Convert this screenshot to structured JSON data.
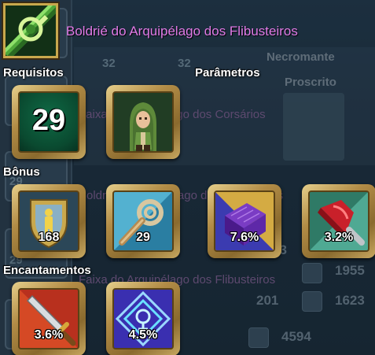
{
  "item": {
    "name": "Boldrié do Arquipélago dos Flibusteiros",
    "icon": "green-belt-icon"
  },
  "sections": {
    "requirements": "Requisitos",
    "parameters": "Parâmetros",
    "bonus": "Bônus",
    "enchantments": "Encantamentos"
  },
  "requirements": {
    "level": "29",
    "character_icon": "hooded-character-icon"
  },
  "bonus": [
    {
      "icon": "shield-figure-icon",
      "value": "168"
    },
    {
      "icon": "wind-swirl-icon",
      "value": "29"
    },
    {
      "icon": "purple-cube-icon",
      "value": "7.6%"
    },
    {
      "icon": "red-hammer-icon",
      "value": "3.2%"
    }
  ],
  "enchantments": [
    {
      "icon": "red-sword-icon",
      "value": "3.6%"
    },
    {
      "icon": "blue-rune-icon",
      "value": "4.5%"
    }
  ],
  "background": {
    "texts": [
      "Necromante",
      "Proscrito",
      "Faixa do Arquipélago dos Corsários",
      "Boldrié do Arquipélago dos Flibusteiros",
      "Faixa do Arquipélago dos Flibusteiros"
    ],
    "levels": [
      "32",
      "32",
      "29",
      "29"
    ],
    "stats": [
      "33",
      "1955",
      "201",
      "1623",
      "4594"
    ]
  },
  "colors": {
    "item_name": "#e07ae6",
    "frame_gold": "#c9a84d",
    "label_white": "#ffffff"
  }
}
